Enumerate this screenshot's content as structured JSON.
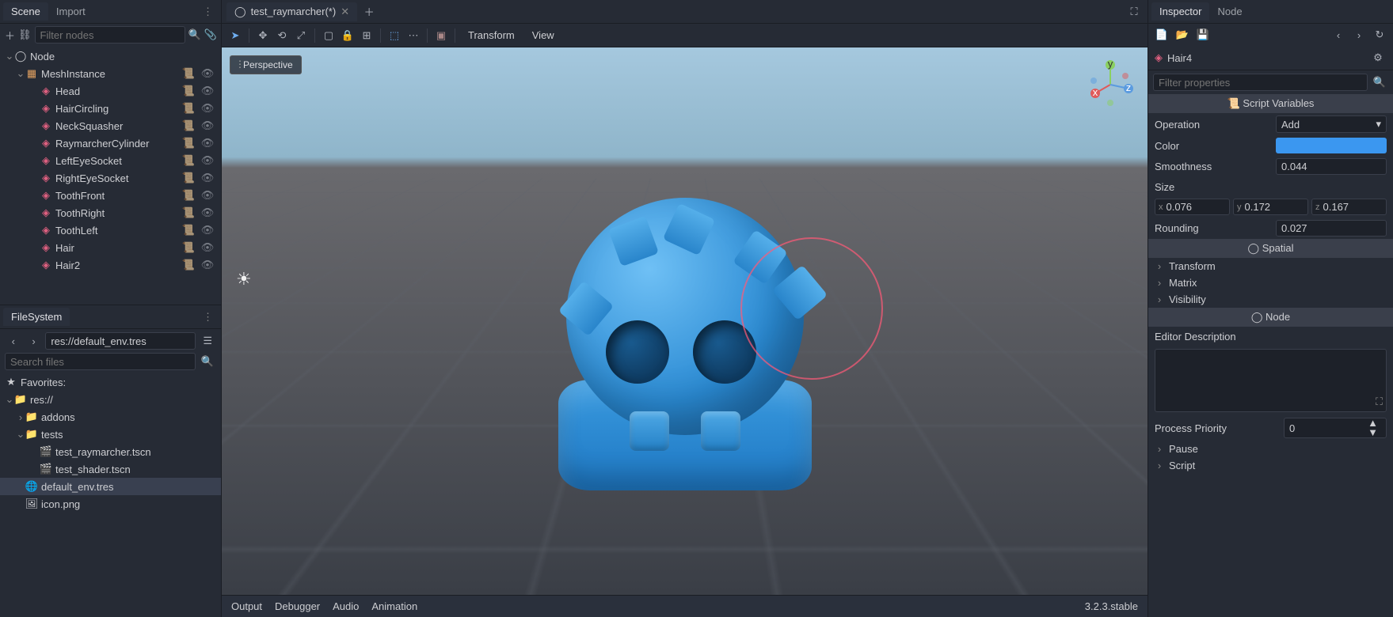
{
  "scene_dock": {
    "tabs": [
      "Scene",
      "Import"
    ],
    "active_tab": 0,
    "filter_placeholder": "Filter nodes",
    "tree": [
      {
        "label": "Node",
        "indent": 0,
        "icon": "circle",
        "expand": "open"
      },
      {
        "label": "MeshInstance",
        "indent": 1,
        "icon": "mesh",
        "expand": "open",
        "script": true,
        "vis": true
      },
      {
        "label": "Head",
        "indent": 2,
        "icon": "ray",
        "script": true,
        "vis": true
      },
      {
        "label": "HairCircling",
        "indent": 2,
        "icon": "ray",
        "script": true,
        "vis": true
      },
      {
        "label": "NeckSquasher",
        "indent": 2,
        "icon": "ray",
        "script": true,
        "vis": true
      },
      {
        "label": "RaymarcherCylinder",
        "indent": 2,
        "icon": "ray",
        "script": true,
        "vis": true
      },
      {
        "label": "LeftEyeSocket",
        "indent": 2,
        "icon": "ray",
        "script": true,
        "vis": true
      },
      {
        "label": "RightEyeSocket",
        "indent": 2,
        "icon": "ray",
        "script": true,
        "vis": true
      },
      {
        "label": "ToothFront",
        "indent": 2,
        "icon": "ray",
        "script": true,
        "vis": true
      },
      {
        "label": "ToothRight",
        "indent": 2,
        "icon": "ray",
        "script": true,
        "vis": true
      },
      {
        "label": "ToothLeft",
        "indent": 2,
        "icon": "ray",
        "script": true,
        "vis": true
      },
      {
        "label": "Hair",
        "indent": 2,
        "icon": "ray",
        "script": true,
        "vis": true
      },
      {
        "label": "Hair2",
        "indent": 2,
        "icon": "ray",
        "script": true,
        "vis": true
      }
    ]
  },
  "filesystem": {
    "tab": "FileSystem",
    "path": "res://default_env.tres",
    "search_placeholder": "Search files",
    "favorites_label": "Favorites:",
    "items": [
      {
        "label": "res://",
        "indent": 0,
        "icon": "folder",
        "expand": "open"
      },
      {
        "label": "addons",
        "indent": 1,
        "icon": "folder",
        "expand": "closed"
      },
      {
        "label": "tests",
        "indent": 1,
        "icon": "folder",
        "expand": "open"
      },
      {
        "label": "test_raymarcher.tscn",
        "indent": 2,
        "icon": "scene"
      },
      {
        "label": "test_shader.tscn",
        "indent": 2,
        "icon": "scene"
      },
      {
        "label": "default_env.tres",
        "indent": 1,
        "icon": "env",
        "selected": true
      },
      {
        "label": "icon.png",
        "indent": 1,
        "icon": "image"
      }
    ]
  },
  "scene_tabs": {
    "items": [
      {
        "label": "test_raymarcher(*)",
        "icon": "circle"
      }
    ]
  },
  "viewport": {
    "menu_transform": "Transform",
    "menu_view": "View",
    "perspective_label": "Perspective"
  },
  "bottom": {
    "items": [
      "Output",
      "Debugger",
      "Audio",
      "Animation"
    ],
    "version": "3.2.3.stable"
  },
  "inspector": {
    "tabs": [
      "Inspector",
      "Node"
    ],
    "active_tab": 0,
    "object_name": "Hair4",
    "filter_placeholder": "Filter properties",
    "section_script_vars": "Script Variables",
    "section_spatial": "Spatial",
    "section_node": "Node",
    "props": {
      "operation": {
        "label": "Operation",
        "value": "Add"
      },
      "color": {
        "label": "Color",
        "value": "#3b97f0"
      },
      "smoothness": {
        "label": "Smoothness",
        "value": "0.044"
      },
      "size": {
        "label": "Size",
        "x": "0.076",
        "y": "0.172",
        "z": "0.167"
      },
      "rounding": {
        "label": "Rounding",
        "value": "0.027"
      }
    },
    "foldables": [
      "Transform",
      "Matrix",
      "Visibility"
    ],
    "editor_description": "Editor Description",
    "process_priority": {
      "label": "Process Priority",
      "value": "0"
    },
    "pause": "Pause",
    "script": "Script"
  }
}
